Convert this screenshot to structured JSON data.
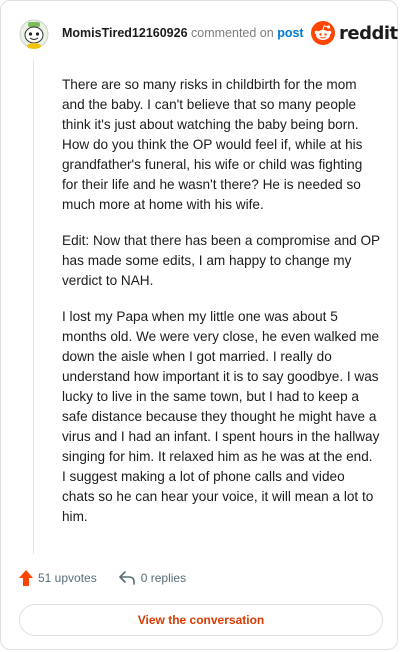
{
  "header": {
    "username": "MomisTired12160926",
    "action_text": "commented on",
    "post_link": "post",
    "brand": "reddit"
  },
  "comment": {
    "paragraphs": [
      "There are so many risks in childbirth for the mom and the baby. I can't believe that so many people think it's just about watching the baby being born. How do you think the OP would feel if, while at his grandfather's funeral, his wife or child was fighting for their life and he wasn't there? He is needed so much more at home with his wife.",
      "Edit: Now that there has been a compromise and OP has made some edits, I am happy to change my verdict to NAH.",
      "I lost my Papa when my little one was about 5 months old. We were very close, he even walked me down the aisle when I got married. I really do understand how important it is to say goodbye. I was lucky to live in the same town, but I had to keep a safe distance because they thought he might have a virus and I had an infant. I spent hours in the hallway singing for him. It relaxed him as he was at the end. I suggest making a lot of phone calls and video chats so he can hear your voice, it will mean a lot to him."
    ]
  },
  "actions": {
    "upvotes": "51 upvotes",
    "replies": "0 replies"
  },
  "footer": {
    "view_button": "View the conversation"
  },
  "colors": {
    "accent": "#ff4500",
    "link": "#0079d3",
    "button_text": "#d93a00"
  },
  "icons": {
    "avatar": "snoo-avatar",
    "logo": "reddit-snoo-icon",
    "upvote": "upvote-arrow-icon",
    "reply": "reply-arrow-icon"
  }
}
